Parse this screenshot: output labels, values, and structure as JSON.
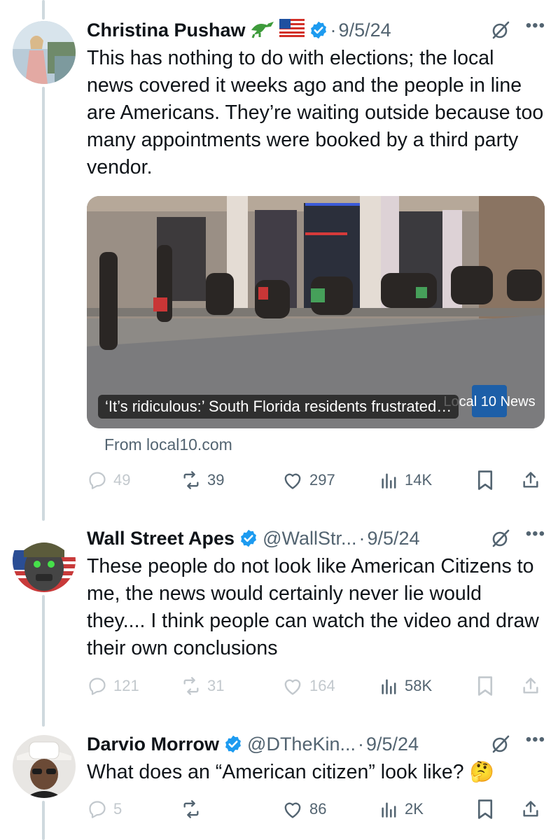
{
  "tweets": [
    {
      "name": "Christina Pushaw",
      "handle": "",
      "date": "9/5/24",
      "text": "This has nothing to do with elections; the local news covered it weeks ago and the people in line are Americans. They’re waiting outside because too many appointments were booked by a third party vendor.",
      "card": {
        "caption": "‘It’s ridiculous:’ South Florida residents frustrated…",
        "source": "From local10.com",
        "logo": "Local 10 News"
      },
      "stats": {
        "replies": "49",
        "reposts": "39",
        "likes": "297",
        "views": "14K"
      }
    },
    {
      "name": "Wall Street Apes",
      "handle": "@WallStr...",
      "date": "9/5/24",
      "text": "These people do not look like American Citizens to me, the news would certainly never lie would they.... I think people can watch the video and draw their own conclusions",
      "stats": {
        "replies": "121",
        "reposts": "31",
        "likes": "164",
        "views": "58K"
      }
    },
    {
      "name": "Darvio Morrow",
      "handle": "@DTheKin...",
      "date": "9/5/24",
      "text": "What does an “American citizen” look like? 🤔",
      "stats": {
        "replies": "5",
        "reposts": "",
        "likes": "86",
        "views": "2K"
      }
    }
  ],
  "icons": {
    "verified": "verified-badge-icon",
    "grok": "grok-icon",
    "more": "more-icon",
    "reply": "reply-icon",
    "repost": "repost-icon",
    "like": "like-icon",
    "views": "views-icon",
    "bookmark": "bookmark-icon",
    "share": "share-icon"
  },
  "colors": {
    "verified": "#1d9bf0",
    "text": "#0f1419",
    "muted": "#536471",
    "thread": "#cfd9de"
  }
}
